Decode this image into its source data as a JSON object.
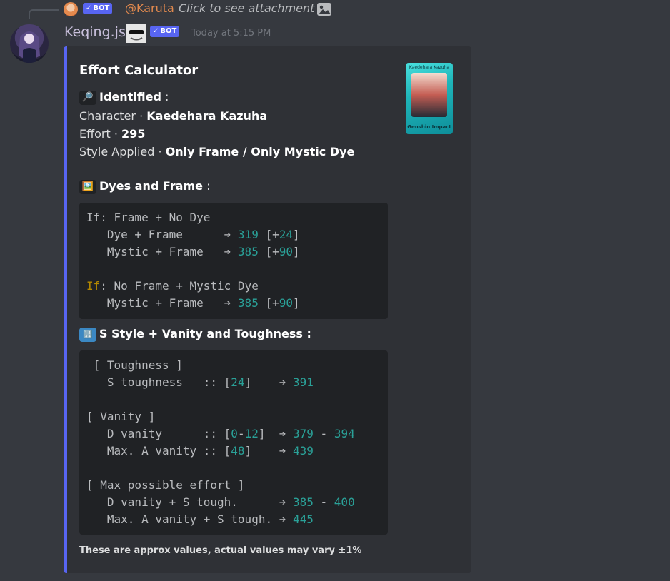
{
  "reply": {
    "bot_label": "BOT",
    "username": "@Karuta",
    "text": "Click to see attachment"
  },
  "message": {
    "username": "Keqing.js",
    "bot_label": "BOT",
    "timestamp": "Today at 5:15 PM"
  },
  "embed": {
    "accent_color": "#5865f2",
    "title": "Effort Calculator",
    "thumbnail": {
      "card_name": "Kaedehara Kazuha",
      "series": "Genshin Impact"
    },
    "identified": {
      "emoji": "🔎",
      "label": "Identified",
      "suffix": " :"
    },
    "character": {
      "label": "Character · ",
      "value": "Kaedehara Kazuha"
    },
    "effort": {
      "label": "Effort · ",
      "value": "295"
    },
    "style": {
      "label": "Style Applied · ",
      "value": "Only Frame / Only Mystic Dye"
    },
    "dyes_section": {
      "emoji": "🖼️",
      "label": "Dyes and Frame",
      "suffix": " :"
    },
    "dyes_block": {
      "if1": "If: Frame + No Dye",
      "row1": {
        "label": "   Dye + Frame      ➔ ",
        "value": "319",
        "pre": " [+",
        "delta": "24",
        "post": "]"
      },
      "row2": {
        "label": "   Mystic + Frame   ➔ ",
        "value": "385",
        "pre": " [+",
        "delta": "90",
        "post": "]"
      },
      "if2_keyword": "If",
      "if2_rest": ": No Frame + Mystic Dye",
      "row3": {
        "label": "   Mystic + Frame   ➔ ",
        "value": "385",
        "pre": " [+",
        "delta": "90",
        "post": "]"
      }
    },
    "style_section": {
      "emoji": "🔢",
      "label": "S Style + Vanity and Toughness",
      "suffix": " :"
    },
    "style_block": {
      "tough_header": " [ Toughness ]",
      "tough_row": {
        "label": "   S toughness   :: [",
        "range": "24",
        "post": "]    ➔ ",
        "value": "391"
      },
      "vanity_header": "[ Vanity ]",
      "vanity_d": {
        "label": "   D vanity      :: [",
        "range_a": "0",
        "dash": "-",
        "range_b": "12",
        "post": "]  ➔ ",
        "value_a": "379",
        "sep": " - ",
        "value_b": "394"
      },
      "vanity_a": {
        "label": "   Max. A vanity :: [",
        "range": "48",
        "post": "]    ➔ ",
        "value": "439"
      },
      "max_header": "[ Max possible effort ]",
      "max_d": {
        "label": "   D vanity + S tough.      ➔ ",
        "value_a": "385",
        "sep": " - ",
        "value_b": "400"
      },
      "max_a": {
        "label": "   Max. A vanity + S tough. ➔ ",
        "value": "445"
      }
    },
    "footer": "These are approx values, actual values may vary ±1%"
  }
}
